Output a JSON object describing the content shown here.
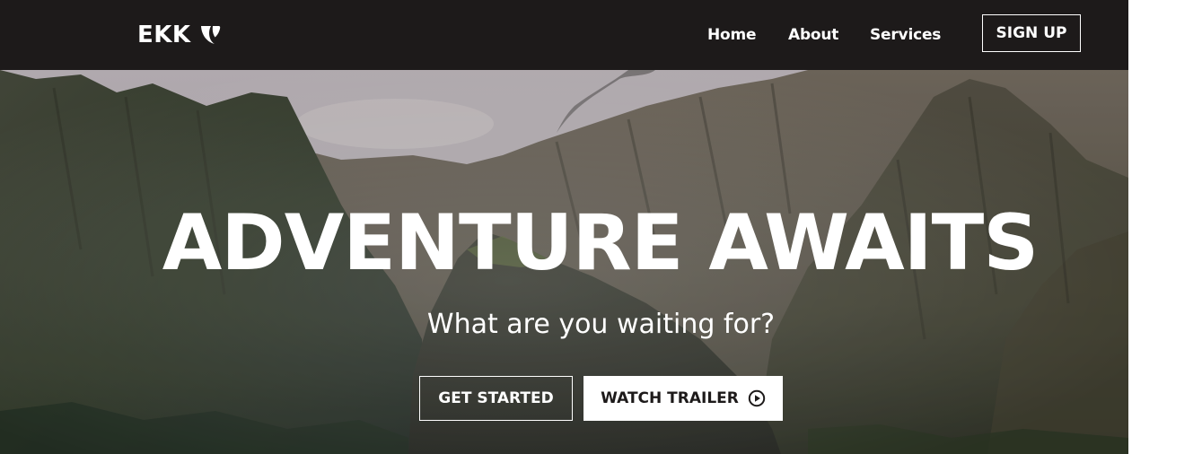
{
  "navbar": {
    "brand": "EKK",
    "brand_icon": "typo3-logo-icon",
    "links": [
      "Home",
      "About",
      "Services"
    ],
    "signup_label": "SIGN UP"
  },
  "hero": {
    "title": "ADVENTURE AWAITS",
    "subtitle": "What are you waiting for?",
    "primary_button": "GET STARTED",
    "secondary_button": "WATCH TRAILER",
    "secondary_button_icon": "play-circle-icon",
    "background": "mountain-landscape-image"
  },
  "colors": {
    "navbar_bg": "#1d1a1a",
    "text_light": "#ffffff",
    "button_dark_text": "#1d1a1a"
  }
}
